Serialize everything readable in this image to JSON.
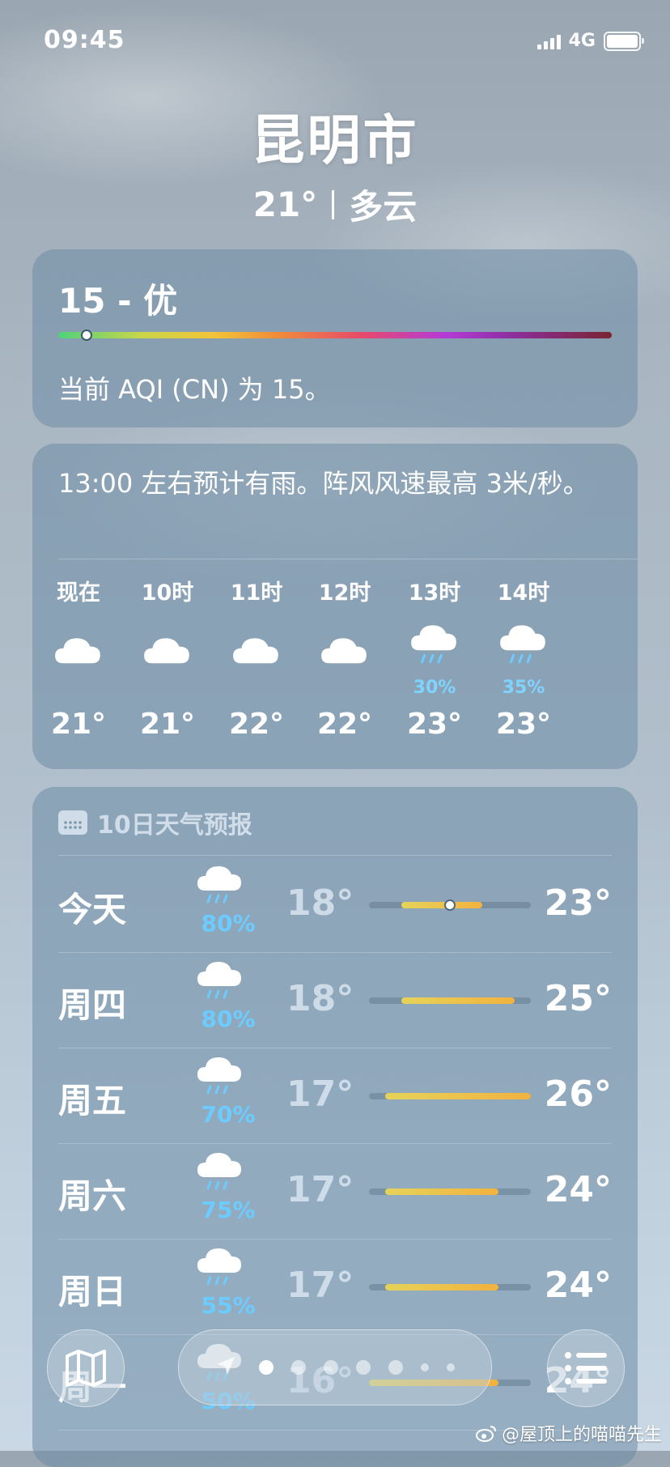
{
  "status": {
    "time": "09:45",
    "network": "4G"
  },
  "location": {
    "city": "昆明市",
    "temp": "21°",
    "condition": "多云"
  },
  "aqi": {
    "value_label": "15 - 优",
    "level": 15,
    "description": "当前 AQI (CN) 为 15。"
  },
  "hourly": {
    "summary": "13:00 左右预计有雨。阵风风速最高 3米/秒。",
    "items": [
      {
        "label": "现在",
        "icon": "cloud-icon",
        "pct": "",
        "temp": "21°"
      },
      {
        "label": "10时",
        "icon": "cloud-icon",
        "pct": "",
        "temp": "21°"
      },
      {
        "label": "11时",
        "icon": "cloud-icon",
        "pct": "",
        "temp": "22°"
      },
      {
        "label": "12时",
        "icon": "cloud-icon",
        "pct": "",
        "temp": "22°"
      },
      {
        "label": "13时",
        "icon": "rain-icon",
        "pct": "30%",
        "temp": "23°"
      },
      {
        "label": "14时",
        "icon": "rain-icon",
        "pct": "35%",
        "temp": "23°"
      }
    ]
  },
  "daily": {
    "title": "10日天气预报",
    "days": [
      {
        "name": "今天",
        "icon": "rain-icon",
        "pct": "80%",
        "low": "18°",
        "high": "23°",
        "low_num": 18,
        "high_num": 23,
        "current": 21
      },
      {
        "name": "周四",
        "icon": "rain-icon",
        "pct": "80%",
        "low": "18°",
        "high": "25°",
        "low_num": 18,
        "high_num": 25
      },
      {
        "name": "周五",
        "icon": "rain-icon",
        "pct": "70%",
        "low": "17°",
        "high": "26°",
        "low_num": 17,
        "high_num": 26
      },
      {
        "name": "周六",
        "icon": "rain-icon",
        "pct": "75%",
        "low": "17°",
        "high": "24°",
        "low_num": 17,
        "high_num": 24
      },
      {
        "name": "周日",
        "icon": "rain-icon",
        "pct": "55%",
        "low": "17°",
        "high": "24°",
        "low_num": 17,
        "high_num": 24
      },
      {
        "name": "周一",
        "icon": "rain-icon",
        "pct": "50%",
        "low": "16°",
        "high": "24°",
        "low_num": 16,
        "high_num": 24
      }
    ],
    "scale_min": 16,
    "scale_max": 26
  },
  "pager": {
    "pages": 7,
    "active": 0
  },
  "watermark": "@屋顶上的喵喵先生",
  "colors": {
    "precip": "#6ccbff",
    "range_start": "#e5d35a",
    "range_end": "#f2b23e"
  }
}
